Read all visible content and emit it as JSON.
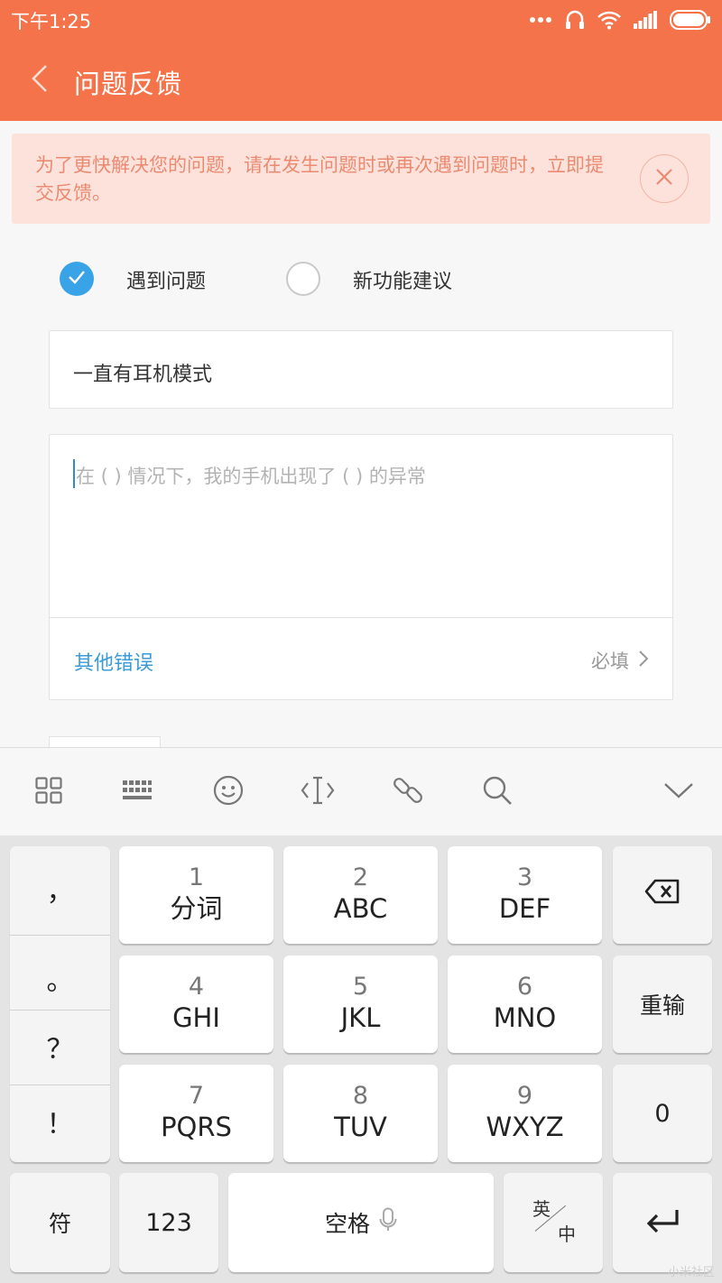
{
  "status_bar": {
    "time": "下午1:25"
  },
  "header": {
    "title": "问题反馈"
  },
  "tip": {
    "text": "为了更快解决您的问题，请在发生问题时或再次遇到问题时，立即提交反馈。"
  },
  "feedback_type": {
    "options": [
      {
        "label": "遇到问题",
        "selected": true
      },
      {
        "label": "新功能建议",
        "selected": false
      }
    ]
  },
  "form": {
    "title_value": "一直有耳机模式",
    "description_placeholder": "在 ( ) 情况下，我的手机出现了 ( ) 的异常",
    "category_label": "其他错误",
    "category_required": "必填"
  },
  "keyboard": {
    "punctuation": [
      "，",
      "。",
      "？",
      "！"
    ],
    "keys": [
      {
        "num": "1",
        "letters": "分词"
      },
      {
        "num": "2",
        "letters": "ABC"
      },
      {
        "num": "3",
        "letters": "DEF"
      },
      {
        "num": "4",
        "letters": "GHI"
      },
      {
        "num": "5",
        "letters": "JKL"
      },
      {
        "num": "6",
        "letters": "MNO"
      },
      {
        "num": "7",
        "letters": "PQRS"
      },
      {
        "num": "8",
        "letters": "TUV"
      },
      {
        "num": "9",
        "letters": "WXYZ"
      }
    ],
    "retype": "重输",
    "zero": "0",
    "symbols": "符",
    "numbers": "123",
    "space": "空格",
    "lang_en": "英",
    "lang_zh": "中"
  },
  "watermark": "小米社区",
  "colors": {
    "accent": "#f4734b",
    "check": "#39a3e8",
    "link": "#3a9bd8",
    "tip_text": "#ea8b71",
    "tip_bg": "#fde2dc"
  }
}
